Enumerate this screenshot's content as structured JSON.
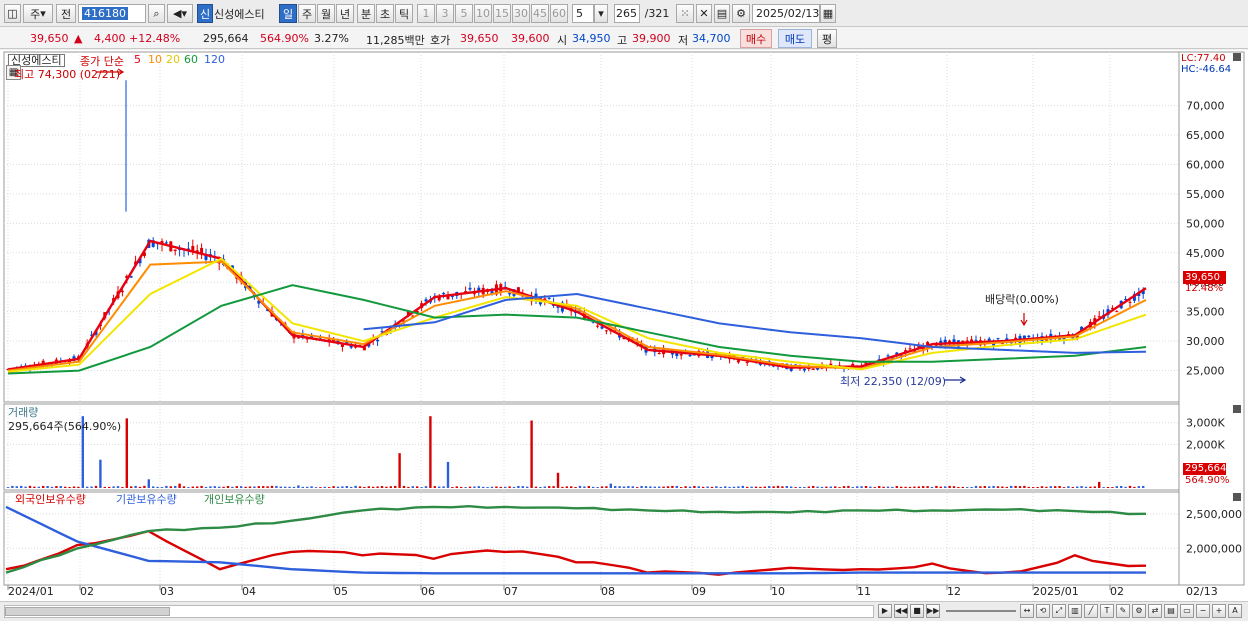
{
  "toolbar": {
    "market": "주",
    "period_mode": "전",
    "code": "416180",
    "stock_badge": "신",
    "stock_name": "신성에스티",
    "period_day": "일",
    "period_week": "주",
    "period_month": "월",
    "period_year": "년",
    "period_minute": "분",
    "period_second": "초",
    "period_tick": "틱",
    "intervals": [
      "1",
      "3",
      "5",
      "10",
      "15",
      "30",
      "45",
      "60"
    ],
    "interval_value": "5",
    "count": "265",
    "total": "/321",
    "date": "2025/02/13"
  },
  "quote": {
    "price": "39,650",
    "arrow": "▲",
    "change": "4,400",
    "change_pct": "+12.48%",
    "volume": "295,664",
    "volume_pct": "564.90%",
    "turnover_pct": "3.27%",
    "amount": "11,285백만",
    "bid_label": "호가",
    "ask": "39,650",
    "bid": "39,600",
    "open_label": "시",
    "open": "34,950",
    "high_label": "고",
    "high": "39,900",
    "low_label": "저",
    "low": "34,700",
    "buy": "매수",
    "sell": "매도",
    "eval": "평"
  },
  "price_panel": {
    "name_tag": "신성에스티",
    "ma_label": "종가 단순",
    "ma_periods": [
      "5",
      "10",
      "20",
      "60",
      "120"
    ],
    "ma_colors": [
      "#e60012",
      "#ff8c00",
      "#f2e600",
      "#12993e",
      "#2e5fdc"
    ],
    "max_label": "최고 74,300 (02/21)",
    "min_label": "최저 22,350 (12/09)",
    "dividend_label": "배당락(0.00%)",
    "lc_label": "LC:77.40",
    "hc_label": "HC:-46.64",
    "last_price": "39,650",
    "last_pct": "12.48%",
    "y_ticks": [
      "70,000",
      "65,000",
      "60,000",
      "55,000",
      "50,000",
      "45,000",
      "40,000",
      "35,000",
      "30,000",
      "25,000"
    ]
  },
  "volume_panel": {
    "title": "거래량",
    "readout": "295,664주(564.90%)",
    "y_ticks": [
      "3,000K",
      "2,000K"
    ],
    "last_value": "295,664",
    "last_pct": "564.90%"
  },
  "holding_panel": {
    "series_names": [
      "외국인보유수량",
      "기관보유수량",
      "개인보유수량"
    ],
    "colors": [
      "#d80000",
      "#2e5fdc",
      "#2e8b45"
    ],
    "y_ticks": [
      "2,500,000",
      "2,000,000"
    ]
  },
  "x_axis": {
    "labels": [
      "2024/01",
      "02",
      "03",
      "04",
      "05",
      "06",
      "07",
      "08",
      "09",
      "10",
      "11",
      "12",
      "2025/01",
      "02",
      "02/13"
    ]
  },
  "chart_data": [
    {
      "type": "line",
      "title": "신성에스티",
      "ylim": [
        20000,
        77400
      ],
      "x": [
        "2024/01",
        "02",
        "03",
        "04",
        "05",
        "06",
        "07",
        "08",
        "09",
        "10",
        "11",
        "12",
        "2025/01",
        "02",
        "02/13"
      ],
      "series": [
        {
          "name": "5",
          "values": [
            25200,
            27000,
            47000,
            44000,
            31000,
            29000,
            37500,
            39000,
            35000,
            28500,
            27500,
            25500,
            25700,
            29500,
            30000,
            31000,
            39000
          ]
        },
        {
          "name": "10",
          "values": [
            25000,
            26500,
            43000,
            43500,
            31500,
            29500,
            36000,
            38500,
            35500,
            29000,
            27700,
            25800,
            25300,
            29000,
            29800,
            30800,
            37000
          ]
        },
        {
          "name": "20",
          "values": [
            24800,
            26000,
            38000,
            44000,
            33000,
            30000,
            34000,
            37500,
            36000,
            30500,
            28000,
            26500,
            25200,
            28000,
            29300,
            30300,
            34500
          ]
        },
        {
          "name": "60",
          "values": [
            24500,
            25000,
            29000,
            36000,
            39500,
            37000,
            34000,
            34500,
            34000,
            31500,
            29000,
            27500,
            26500,
            26500,
            27000,
            27500,
            29000
          ]
        },
        {
          "name": "120",
          "values": [
            null,
            null,
            null,
            null,
            null,
            32000,
            33200,
            37000,
            38000,
            35500,
            33000,
            31500,
            30500,
            29000,
            28500,
            28000,
            28200
          ]
        }
      ],
      "annotations": [
        "최고 74,300 (02/21)",
        "최저 22,350 (12/09)",
        "배당락(0.00%)"
      ]
    },
    {
      "type": "bar",
      "title": "거래량",
      "ylim": [
        0,
        3400000
      ],
      "values_note": "",
      "series": [
        {
          "name": "거래량",
          "values": [
            40000,
            60000,
            3300000,
            1300000,
            3200000,
            400000,
            200000,
            120000,
            90000,
            1600000,
            3300000,
            1200000,
            3100000,
            700000,
            200000,
            80000,
            60000,
            280000,
            295664
          ]
        }
      ]
    },
    {
      "type": "line",
      "ylim": [
        1500000,
        2700000
      ],
      "x": [
        "2024/01",
        "02",
        "03",
        "04",
        "05",
        "06",
        "07",
        "08",
        "09",
        "10",
        "11",
        "12",
        "2025/01",
        "02",
        "02/13"
      ],
      "series": [
        {
          "name": "외국인보유수량",
          "values": [
            1700000,
            2050000,
            2250000,
            1700000,
            1950000,
            1900000,
            1850000,
            1950000,
            1800000,
            1650000,
            1620000,
            1720000,
            1700000,
            1780000,
            1650000,
            1900000,
            1750000
          ]
        },
        {
          "name": "기관보유수량",
          "values": [
            2600000,
            2100000,
            1820000,
            1800000,
            1700000,
            1650000,
            1640000,
            1640000,
            1640000,
            1640000,
            1640000,
            1640000,
            1650000,
            1650000,
            1650000,
            1650000,
            1650000
          ]
        },
        {
          "name": "개인보유수량",
          "values": [
            1650000,
            2000000,
            2250000,
            2300000,
            2400000,
            2550000,
            2600000,
            2600000,
            2580000,
            2550000,
            2530000,
            2520000,
            2550000,
            2550000,
            2560000,
            2540000,
            2500000
          ]
        }
      ]
    }
  ]
}
